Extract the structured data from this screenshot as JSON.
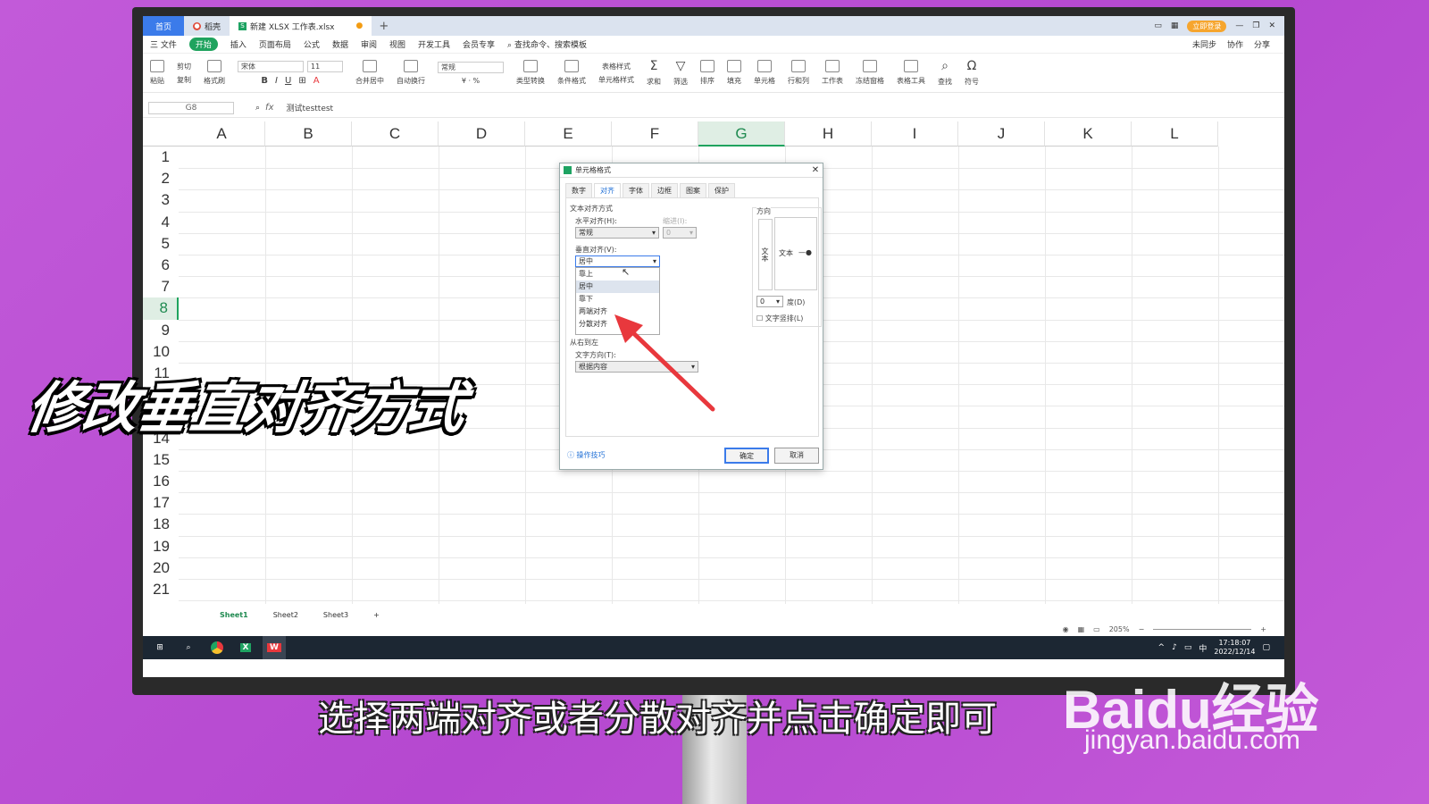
{
  "tabs": {
    "home": "首页",
    "docer": "稻壳",
    "file": "新建 XLSX 工作表.xlsx"
  },
  "titlebar": {
    "login": "立即登录"
  },
  "menu": {
    "items": [
      "三 文件",
      "开始",
      "插入",
      "页面布局",
      "公式",
      "数据",
      "审阅",
      "视图",
      "开发工具",
      "会员专享"
    ],
    "search": "查找命令、搜索模板",
    "right": [
      "未同步",
      "协作",
      "分享"
    ]
  },
  "ribbon": {
    "groups": [
      "粘贴",
      "剪切",
      "复制",
      "格式刷",
      "合并居中",
      "自动换行",
      "类型转换",
      "条件格式",
      "表格样式",
      "单元格样式",
      "求和",
      "筛选",
      "排序",
      "填充",
      "单元格",
      "行和列",
      "工作表",
      "冻结窗格",
      "表格工具",
      "查找",
      "符号"
    ],
    "font": "宋体",
    "size": "11",
    "numfmt": "常规"
  },
  "formula": {
    "namebox": "G8",
    "fx": "fx",
    "value": "测试testtest"
  },
  "columns": [
    "A",
    "B",
    "C",
    "D",
    "E",
    "F",
    "G",
    "H",
    "I",
    "J",
    "K",
    "L"
  ],
  "selected_column": "G",
  "rows": [
    "1",
    "2",
    "3",
    "4",
    "5",
    "6",
    "7",
    "8",
    "9",
    "10",
    "11",
    "12",
    "13",
    "14",
    "15",
    "16",
    "17",
    "18",
    "19",
    "20",
    "21"
  ],
  "selected_row": "8",
  "sheets": [
    "Sheet1",
    "Sheet2",
    "Sheet3"
  ],
  "status": {
    "zoom": "205%"
  },
  "taskbar": {
    "time": "17:18:07",
    "date": "2022/12/14",
    "ime": "中"
  },
  "dialog": {
    "title": "单元格格式",
    "tabs": [
      "数字",
      "对齐",
      "字体",
      "边框",
      "图案",
      "保护"
    ],
    "active_tab": "对齐",
    "text_align_section": "文本对齐方式",
    "h_align_label": "水平对齐(H):",
    "h_align_value": "常规",
    "indent_label": "缩进(I):",
    "indent_value": "0",
    "v_align_label": "垂直对齐(V):",
    "v_align_value": "居中",
    "dropdown_options": [
      "靠上",
      "居中",
      "靠下",
      "两端对齐",
      "分散对齐"
    ],
    "rtl_section": "从右到左",
    "text_dir_label": "文字方向(T):",
    "text_dir_value": "根据内容",
    "orientation_label": "方向",
    "vertical_text": "文本",
    "dial_text": "文本",
    "degree_value": "0",
    "degree_label": "度(D)",
    "vertical_checkbox": "文字竖排(L)",
    "tips": "操作技巧",
    "ok": "确定",
    "cancel": "取消"
  },
  "overlay": {
    "title": "修改垂直对齐方式",
    "caption": "选择两端对齐或者分散对齐并点击确定即可"
  },
  "watermark": {
    "brand": "Baidu经验",
    "url": "jingyan.baidu.com"
  },
  "colors": {
    "accent": "#1fa35e",
    "tab_blue": "#3b7bea",
    "arrow": "#e8383d",
    "background": "#c25ad9"
  }
}
